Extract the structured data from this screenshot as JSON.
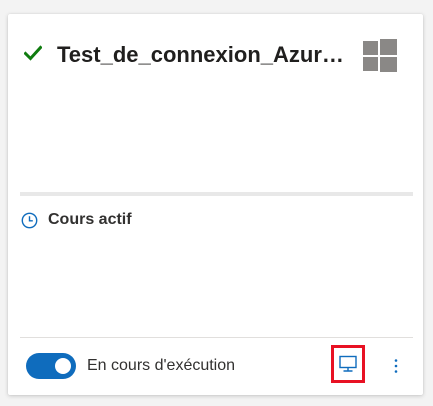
{
  "card": {
    "title": "Test_de_connexion_Azure...",
    "status_icon": "check-icon",
    "os_icon": "windows-icon"
  },
  "schedule": {
    "icon": "clock-icon",
    "label": "Cours actif"
  },
  "footer": {
    "toggle_on": true,
    "toggle_label": "En cours d'exécution",
    "connect_icon": "monitor-icon",
    "more_icon": "more-vertical-icon"
  },
  "colors": {
    "accent": "#0f6cbd",
    "success": "#107c10",
    "highlight": "#e81123",
    "os_icon": "#8a8886"
  }
}
